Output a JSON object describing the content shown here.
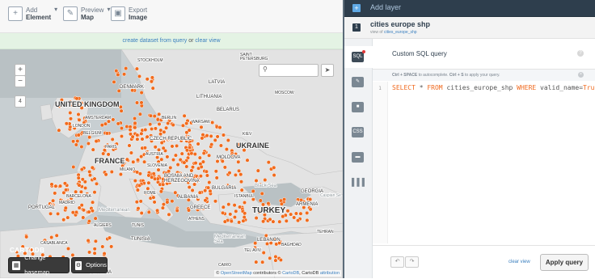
{
  "toolbar": {
    "add_element": {
      "small": "Add",
      "label": "Element",
      "icon": "plus-icon"
    },
    "preview_map": {
      "small": "Preview",
      "label": "Map",
      "icon": "pencil-icon"
    },
    "export_image": {
      "small": "Export",
      "label": "Image",
      "icon": "image-icon"
    }
  },
  "infobar": {
    "link1": "create dataset from query",
    "or": "or",
    "link2": "clear view"
  },
  "map": {
    "labels": {
      "stockholm": "STOCKHOLM",
      "st_petersburg": "SAINT\nPETERSBURG",
      "latvia": "LATVIA",
      "denmark": "DENMARK",
      "lithuania": "LITHUANIA",
      "moscow": "MOSCOW",
      "uk": "UNITED KINGDOM",
      "amsterdam": "AMSTERDAM",
      "berlin": "BERLIN",
      "belarus": "BELARUS",
      "warsaw": "WARSAW",
      "london": "LONDON",
      "belgium": "BELGIUM",
      "paris": "PARIS",
      "czech": "CZECH REPUBLIC",
      "kiev": "KIEV",
      "ukraine": "UKRAINE",
      "austria": "AUSTRIA",
      "france": "FRANCE",
      "slovenia": "SLOVENIA",
      "moldova": "MOLDOVA",
      "milano": "MILANO",
      "bosnia": "BOSNIA AND\nHERZEGOVINA",
      "bulgaria": "BULGARIA",
      "black_sea": "Black Sea",
      "georgia": "GEORGIA",
      "rome": "ROME",
      "albania": "ALBANIA",
      "istanbul": "ISTANBUL",
      "barcelona": "BARCELONA",
      "madrid": "MADRID",
      "portugal": "PORTUGAL",
      "greece": "GREECE",
      "turkey": "TURKEY",
      "armenia": "ARMENIA",
      "caspian": "Caspian Se",
      "mediterranean": "Mediterranean",
      "athens": "ATHENS",
      "algiers": "ALGIERS",
      "tunis": "TUNIS",
      "tehran": "TEHRAN",
      "casablanca": "CASABLANCA",
      "tunisia": "TUNISIA",
      "med_sea": "Mediterranean\nSea",
      "lebanon": "LEBANON",
      "baghdad": "BAGHDAD",
      "tel_aviv": "TEL AVIV",
      "cairo": "CAIRO",
      "algeria": "ALGERIA"
    },
    "zoom_in": "+",
    "zoom_out": "−",
    "layer_count": "4",
    "logo": "CARTODB",
    "change_basemap": "Change basemap",
    "options": "Options",
    "attribution_prefix": "©",
    "attr_osm": "OpenStreetMap",
    "attr_mid": "contributors ©",
    "attr_cartodb": "CartoDB",
    "attr_comma": ",",
    "attr_cdb": "CartoDB",
    "attr_attribution": "attribution",
    "dot_color": "#f26a1b"
  },
  "right": {
    "add_layer": "Add layer",
    "layer_number": "1",
    "layer_name": "cities europe shp",
    "layer_sub_prefix": "view of",
    "layer_sub_link": "cities_europe_shp",
    "panel_title": "Custom SQL query",
    "hint_part1": "Ctrl + SPACE",
    "hint_part2": "to autocomplete.",
    "hint_part3": "Ctrl + S",
    "hint_part4": "to apply your query.",
    "line_number": "1",
    "sql": {
      "select": "SELECT",
      "star": " * ",
      "from": "FROM",
      "table": " cities_europe_shp ",
      "where": "WHERE",
      "cond": " valid_name=",
      "value": "True"
    },
    "clear_view": "clear view",
    "apply_query": "Apply query",
    "nav_icons": [
      "sql-icon",
      "wizard-icon",
      "infowindow-icon",
      "css-icon",
      "legend-icon",
      "filters-icon"
    ]
  },
  "colors": {
    "accent": "#3a7fbf",
    "orange": "#f26a1b",
    "dark": "#2e3e4d"
  }
}
